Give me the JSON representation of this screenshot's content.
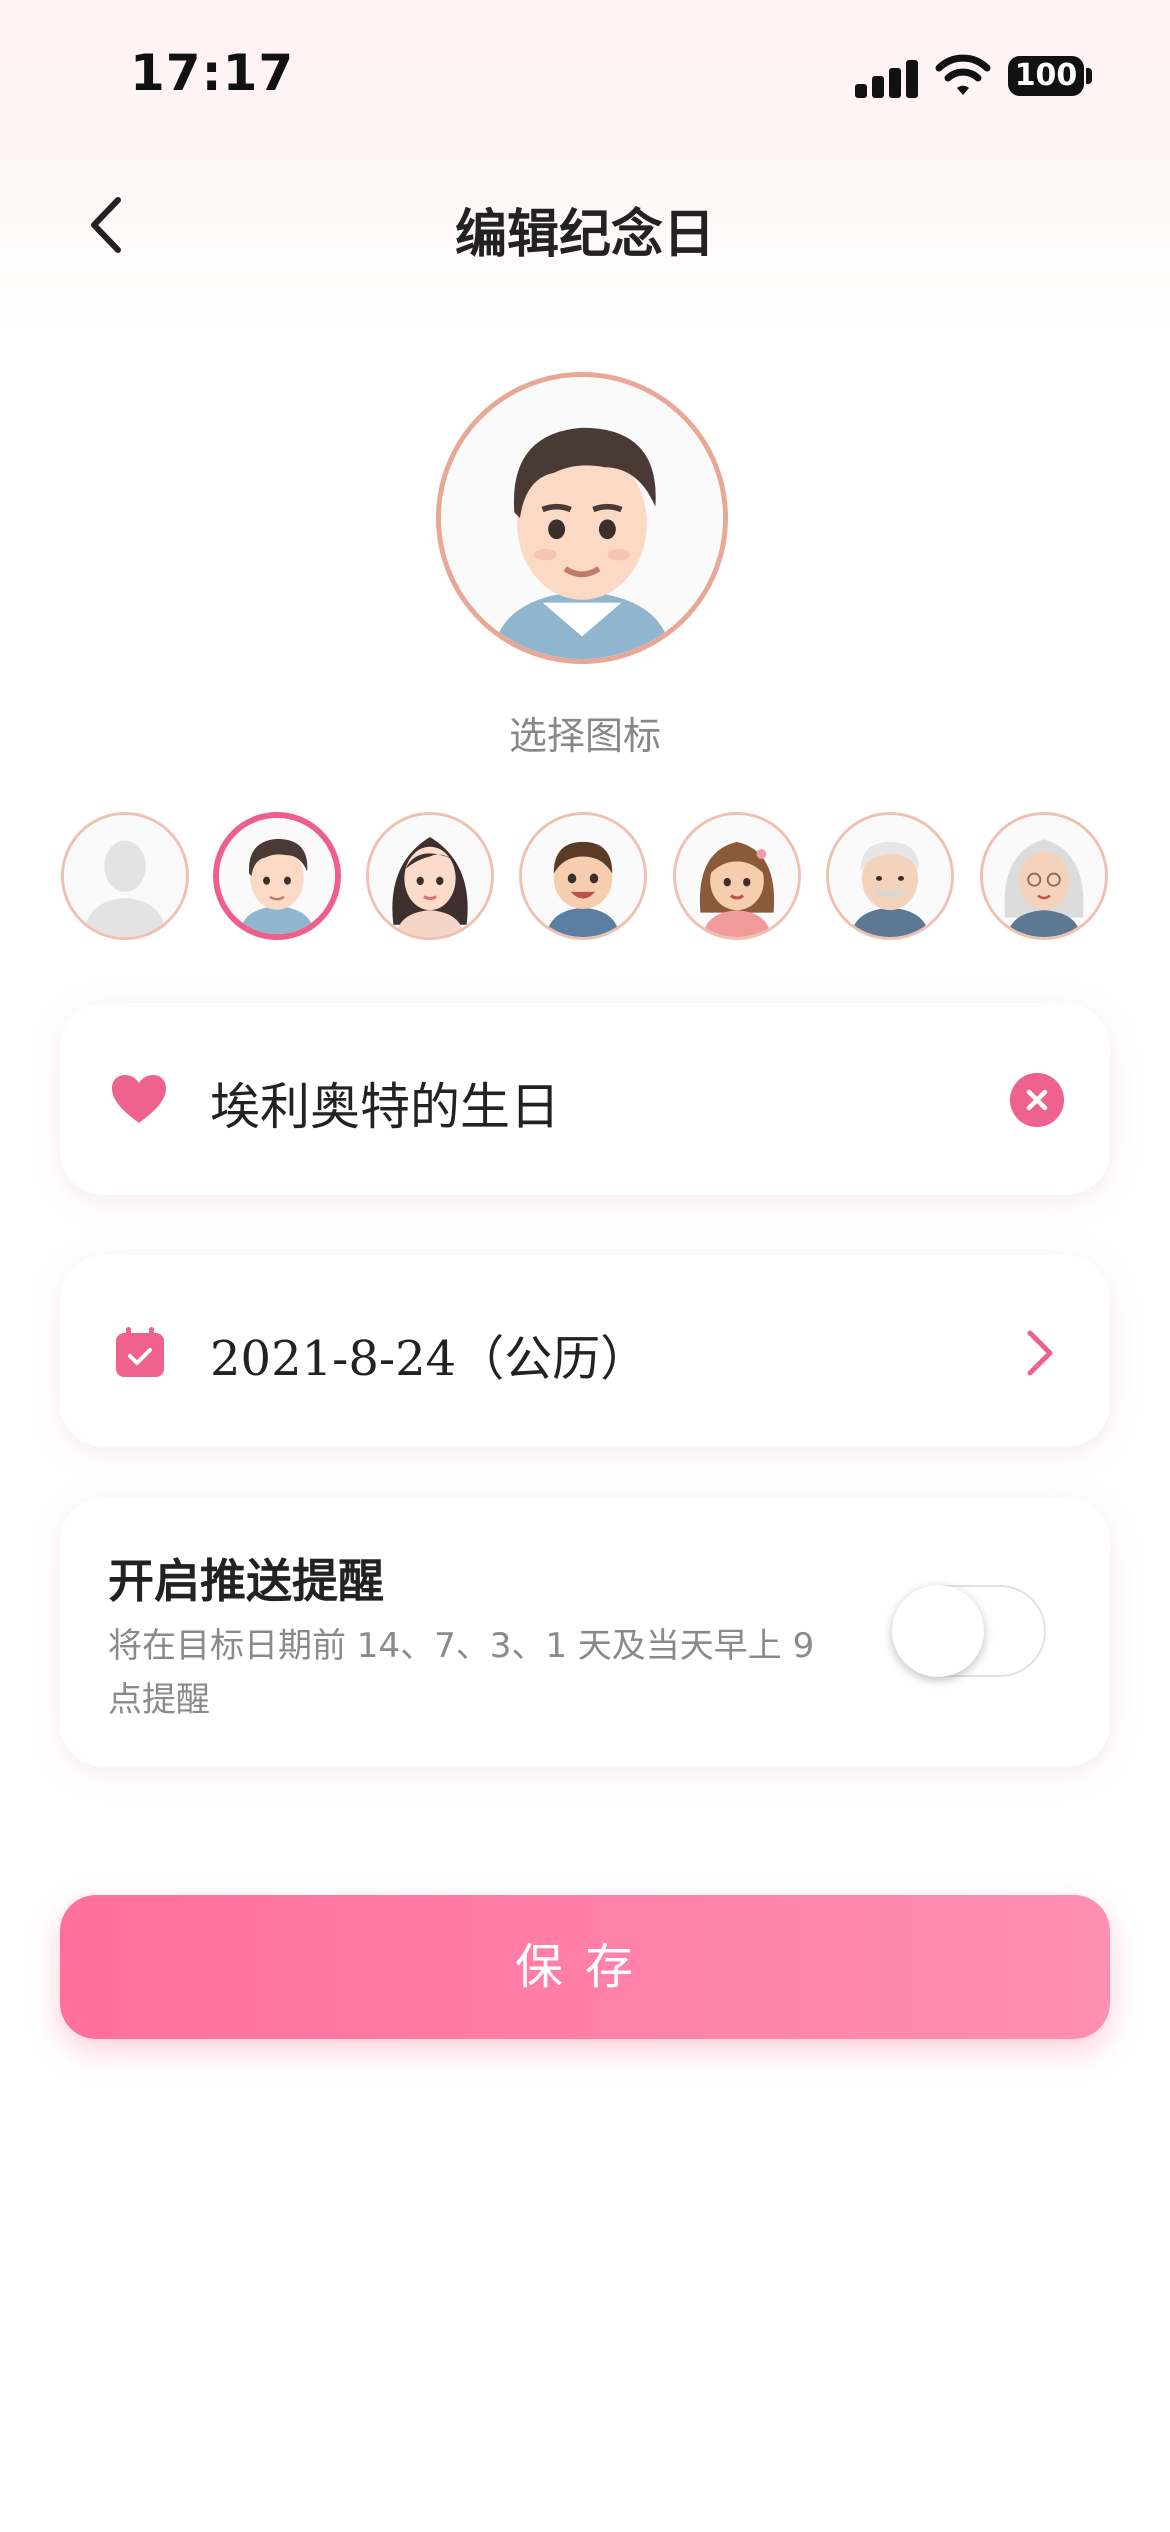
{
  "status_bar": {
    "time": "17:17",
    "battery": "100"
  },
  "header": {
    "title": "编辑纪念日"
  },
  "icon_picker": {
    "label": "选择图标",
    "selected_icon": "man-avatar",
    "options": [
      "default-avatar",
      "man-avatar",
      "woman-avatar",
      "boy-avatar",
      "girl-avatar",
      "grandpa-avatar",
      "grandma-avatar"
    ]
  },
  "name_field": {
    "value": "埃利奥特的生日"
  },
  "date_field": {
    "value": "2021-8-24（公历）"
  },
  "reminder": {
    "title": "开启推送提醒",
    "description": "将在目标日期前 14、7、3、1 天及当天早上 9 点提醒",
    "enabled": false
  },
  "save_button": {
    "label": "保存"
  },
  "colors": {
    "accent": "#f0628e",
    "save_gradient_start": "#ff6f9c",
    "save_gradient_end": "#ff8fb3"
  }
}
